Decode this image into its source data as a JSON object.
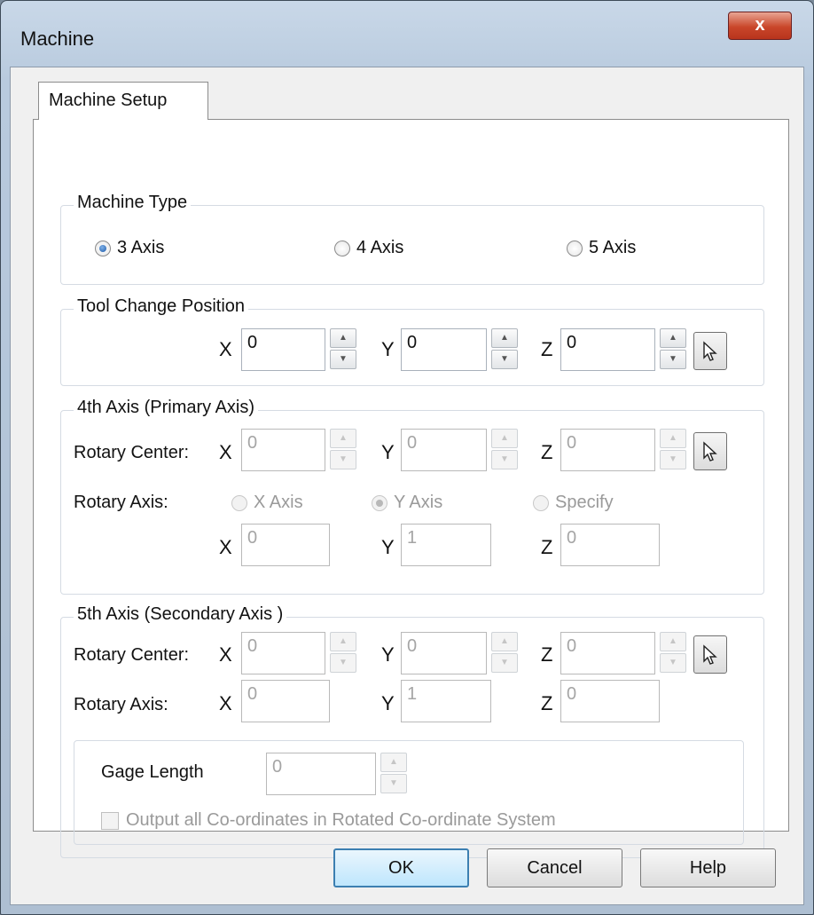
{
  "window": {
    "title": "Machine",
    "close_label": "x"
  },
  "tabs": [
    {
      "label": "Machine Setup"
    }
  ],
  "machine_type": {
    "title": "Machine Type",
    "options": [
      {
        "label": "3 Axis",
        "selected": true
      },
      {
        "label": "4 Axis",
        "selected": false
      },
      {
        "label": "5 Axis",
        "selected": false
      }
    ]
  },
  "tool_change": {
    "title": "Tool Change Position",
    "x_label": "X",
    "y_label": "Y",
    "z_label": "Z",
    "x": "0",
    "y": "0",
    "z": "0"
  },
  "axis4": {
    "title": "4th Axis (Primary Axis)",
    "rotary_center_label": "Rotary Center:",
    "rotary_axis_label": "Rotary Axis:",
    "x_label": "X",
    "y_label": "Y",
    "z_label": "Z",
    "center": {
      "x": "0",
      "y": "0",
      "z": "0"
    },
    "axis_options": [
      {
        "label": "X Axis",
        "selected": false
      },
      {
        "label": "Y Axis",
        "selected": true
      },
      {
        "label": "Specify",
        "selected": false
      }
    ],
    "vector": {
      "x": "0",
      "y": "1",
      "z": "0"
    }
  },
  "axis5": {
    "title": "5th Axis (Secondary Axis )",
    "rotary_center_label": "Rotary Center:",
    "rotary_axis_label": "Rotary Axis:",
    "x_label": "X",
    "y_label": "Y",
    "z_label": "Z",
    "center": {
      "x": "0",
      "y": "0",
      "z": "0"
    },
    "vector": {
      "x": "0",
      "y": "1",
      "z": "0"
    },
    "gage_length_label": "Gage Length",
    "gage_length": "0",
    "output_rotated_label": "Output all Co-ordinates in Rotated Co-ordinate System",
    "output_rotated_checked": false
  },
  "buttons": {
    "ok": "OK",
    "cancel": "Cancel",
    "help": "Help"
  },
  "icons": {
    "pick": "cursor-arrow-icon",
    "spin_up": "spin-up-icon",
    "spin_down": "spin-down-icon"
  }
}
